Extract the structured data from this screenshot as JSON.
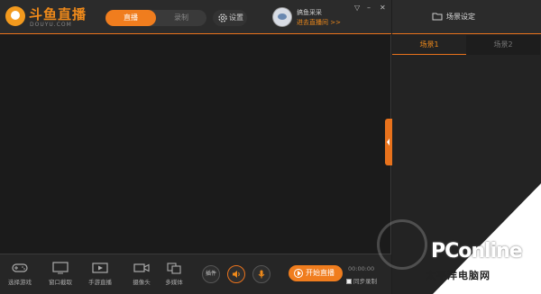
{
  "app": {
    "logo_name": "斗鱼直播",
    "logo_sub": "DOUYU.COM"
  },
  "header": {
    "mode_live": "直播",
    "mode_record": "录制",
    "settings": "设置",
    "user_name": "搞鱼采采",
    "user_link": "进去直播间 >>",
    "dropdown": "▽",
    "minimize": "–",
    "close": "✕"
  },
  "toolbar": {
    "tools": [
      {
        "label": "选择游戏",
        "icon": "gamepad-icon"
      },
      {
        "label": "窗口截取",
        "icon": "monitor-icon"
      },
      {
        "label": "手游直播",
        "icon": "mobile-video-icon"
      },
      {
        "label": "摄像头",
        "icon": "camera-icon"
      },
      {
        "label": "多媒体",
        "icon": "media-icon"
      }
    ],
    "plugin": "插件",
    "start_live": "开始直播",
    "timer": "00:00:00",
    "sync_record": "同步录制"
  },
  "right_panel": {
    "title": "场景设定",
    "scene_tabs": [
      "场景1",
      "场景2"
    ]
  },
  "watermark": {
    "brand": "PConline",
    "cn": "太平洋电脑网"
  },
  "colors": {
    "accent": "#f07d1e",
    "background": "#1e1e1e"
  }
}
